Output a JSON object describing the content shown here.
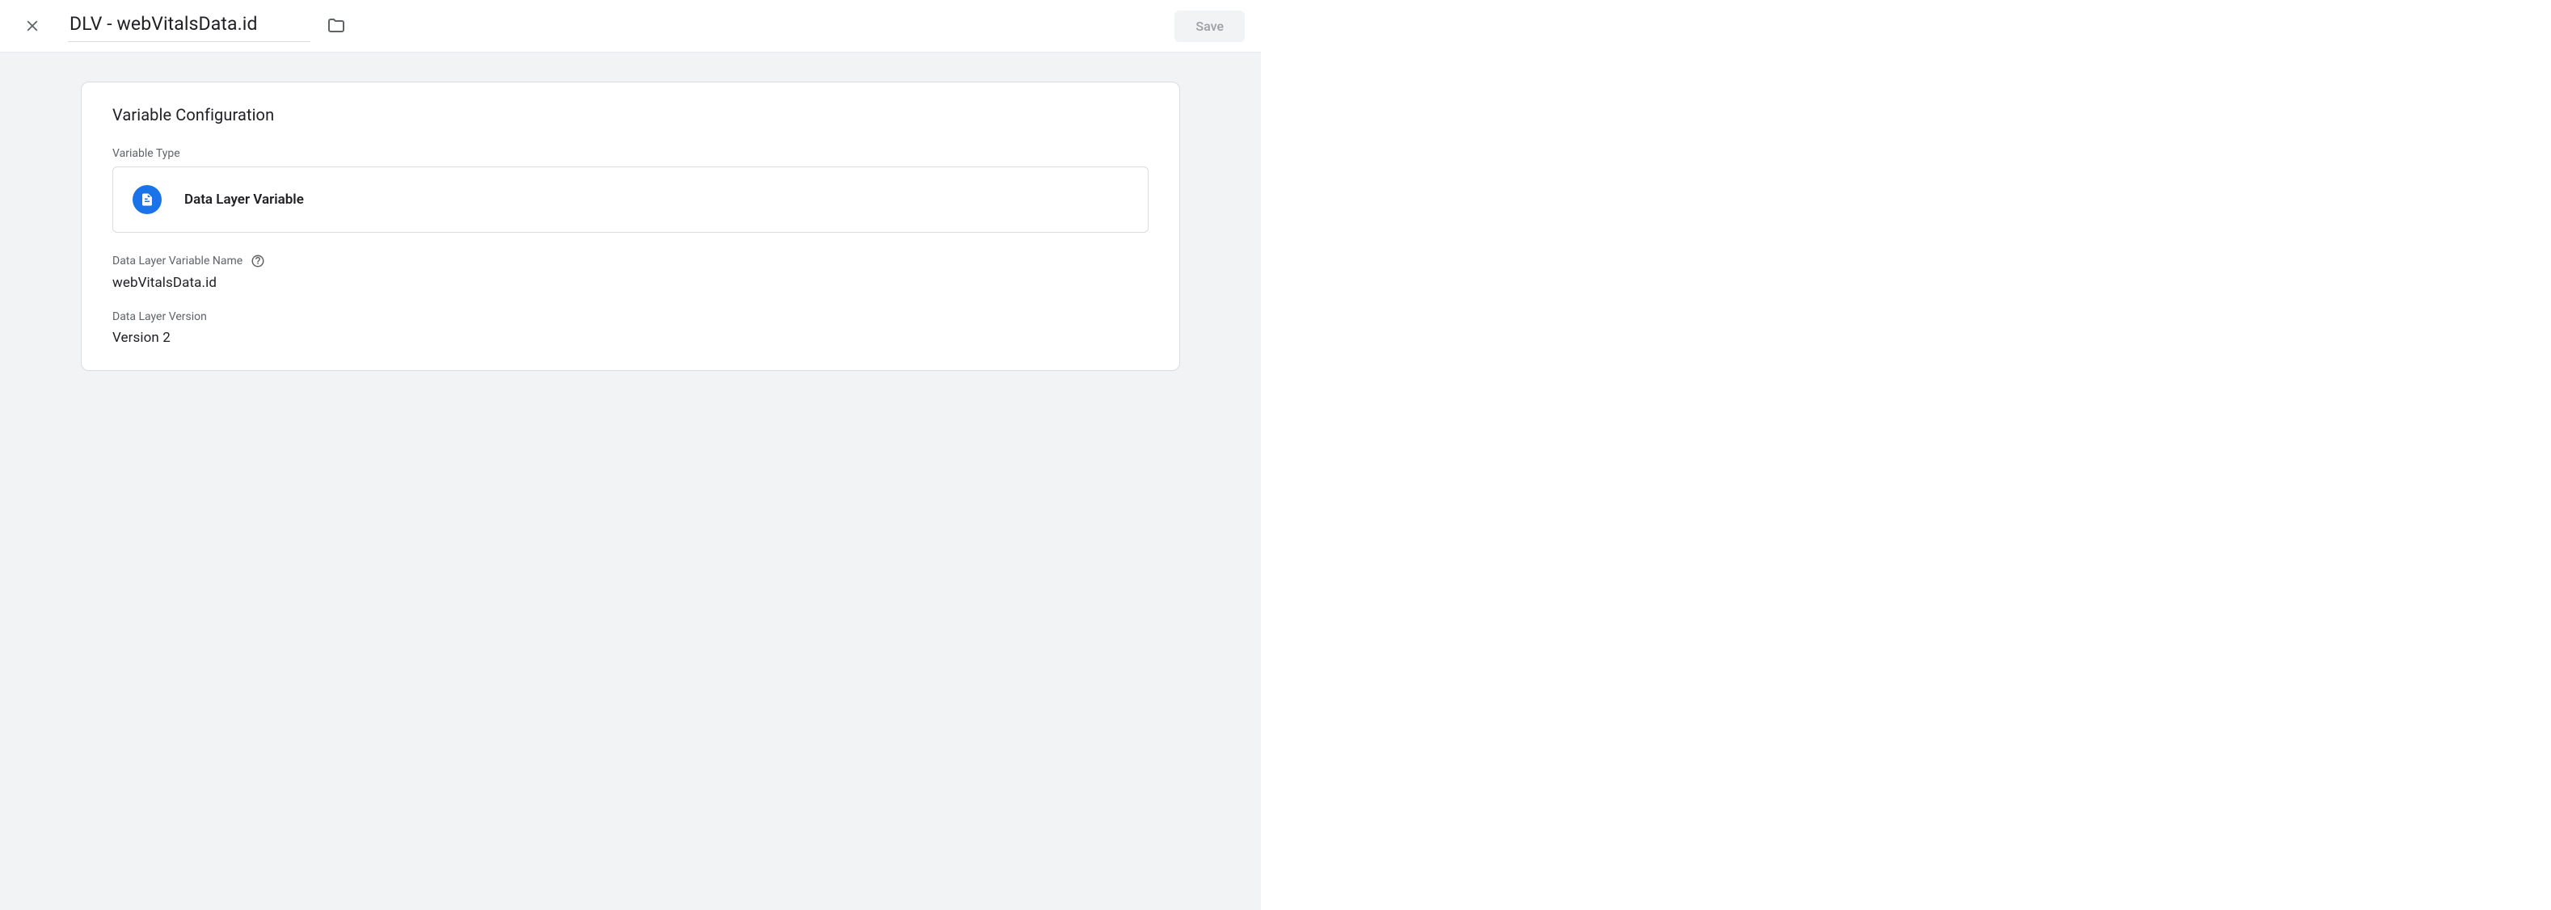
{
  "header": {
    "title": "DLV - webVitalsData.id",
    "save_label": "Save"
  },
  "card": {
    "title": "Variable Configuration",
    "variable_type_label": "Variable Type",
    "variable_type_value": "Data Layer Variable",
    "dlv_name_label": "Data Layer Variable Name",
    "dlv_name_value": "webVitalsData.id",
    "dlv_version_label": "Data Layer Version",
    "dlv_version_value": "Version 2"
  }
}
